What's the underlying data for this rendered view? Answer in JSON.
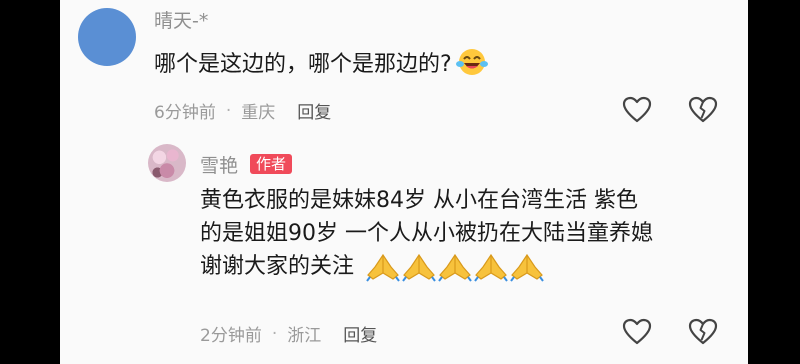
{
  "comment": {
    "username": "晴天-*",
    "text": "哪个是这边的，哪个是那边的?",
    "emoji": "laughing-crying-emoji",
    "time": "6分钟前",
    "location": "重庆",
    "reply_label": "回复"
  },
  "reply": {
    "username": "雪艳",
    "author_tag": "作者",
    "lines": [
      "黄色衣服的是妹妹84岁 从小在台湾生活 紫色",
      "的是姐姐90岁 一个人从小被扔在大陆当童养媳",
      "谢谢大家的关注"
    ],
    "emoji": "folded-hands-emoji",
    "time": "2分钟前",
    "location": "浙江",
    "reply_label": "回复"
  },
  "colors": {
    "author_tag": "#f04a5a",
    "avatar_blue": "#5a8fd4",
    "meta_gray": "#9a9a9a"
  }
}
